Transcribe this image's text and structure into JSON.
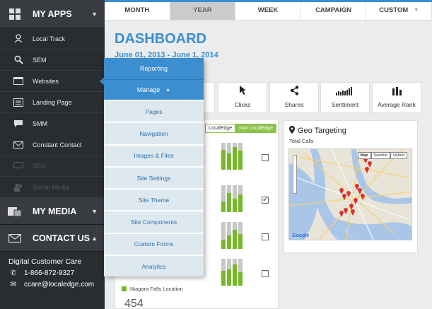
{
  "sidebar": {
    "my_apps": {
      "label": "MY APPS"
    },
    "items": [
      {
        "label": "Local Track",
        "icon": "map-pin-person-icon",
        "enabled": true
      },
      {
        "label": "SEM",
        "icon": "magnifier-icon",
        "enabled": true
      },
      {
        "label": "Websites",
        "icon": "browser-window-icon",
        "enabled": true
      },
      {
        "label": "Landing Page",
        "icon": "landing-page-icon",
        "enabled": true
      },
      {
        "label": "SMM",
        "icon": "chat-bubble-icon",
        "enabled": true
      },
      {
        "label": "Constant Contact",
        "icon": "envelope-icon",
        "enabled": true
      },
      {
        "label": "SEO",
        "icon": "monitor-icon",
        "enabled": false
      },
      {
        "label": "Social Media",
        "icon": "people-icon",
        "enabled": false
      }
    ],
    "my_media": {
      "label": "MY MEDIA"
    },
    "contact_us": {
      "label": "CONTACT US"
    },
    "contact": {
      "title": "Digital Customer Care",
      "phone": "1-866-872-9327",
      "email": "ccare@localedge.com"
    }
  },
  "topbar": {
    "tabs": [
      {
        "label": "MONTH",
        "active": false
      },
      {
        "label": "YEAR",
        "active": true
      },
      {
        "label": "WEEK",
        "active": false
      },
      {
        "label": "CAMPAIGN",
        "active": false
      },
      {
        "label": "CUSTOM",
        "active": false,
        "dropdown": true
      }
    ]
  },
  "dashboard": {
    "title": "DASHBOARD",
    "date_range": "June 01, 2013 - June 1, 2014"
  },
  "metrics": [
    {
      "label": "Clicks",
      "icon": "cursor-icon"
    },
    {
      "label": "Shares",
      "icon": "share-icon"
    },
    {
      "label": "Sentiment",
      "icon": "sentiment-bars-icon"
    },
    {
      "label": "Average Rank",
      "icon": "rank-bars-icon"
    }
  ],
  "legend": {
    "localedge": "LocalEdge",
    "non_localedge": "Non LocalEdge"
  },
  "location_rows": [
    {
      "levels": [
        0.75,
        0.6,
        0.85,
        0.7
      ],
      "checked": false
    },
    {
      "levels": [
        0.4,
        0.7,
        0.5,
        0.65
      ],
      "checked": true
    },
    {
      "levels": [
        0.35,
        0.5,
        0.7,
        0.55
      ],
      "checked": false
    },
    {
      "levels": [
        0.55,
        0.6,
        0.8,
        0.5
      ],
      "checked": false
    }
  ],
  "niagara": {
    "label": "Niagara Falls Location",
    "value": "454"
  },
  "geo": {
    "title": "Geo Targeting",
    "subtitle": "Total Calls",
    "map_buttons": [
      "Map",
      "Satellite",
      "Hybrid"
    ],
    "brand": "Google"
  },
  "dropdown_menu": {
    "reporting": "Reporting",
    "manage": "Manage",
    "sub_items": [
      "Pages",
      "Navigation",
      "Images & Files",
      "Site Settings",
      "Site Theme",
      "Site Components",
      "Custom Forms",
      "Analytics"
    ]
  },
  "colors": {
    "accent": "#3b8ed0",
    "green": "#76b82a",
    "sidebar": "#2a2d30"
  }
}
